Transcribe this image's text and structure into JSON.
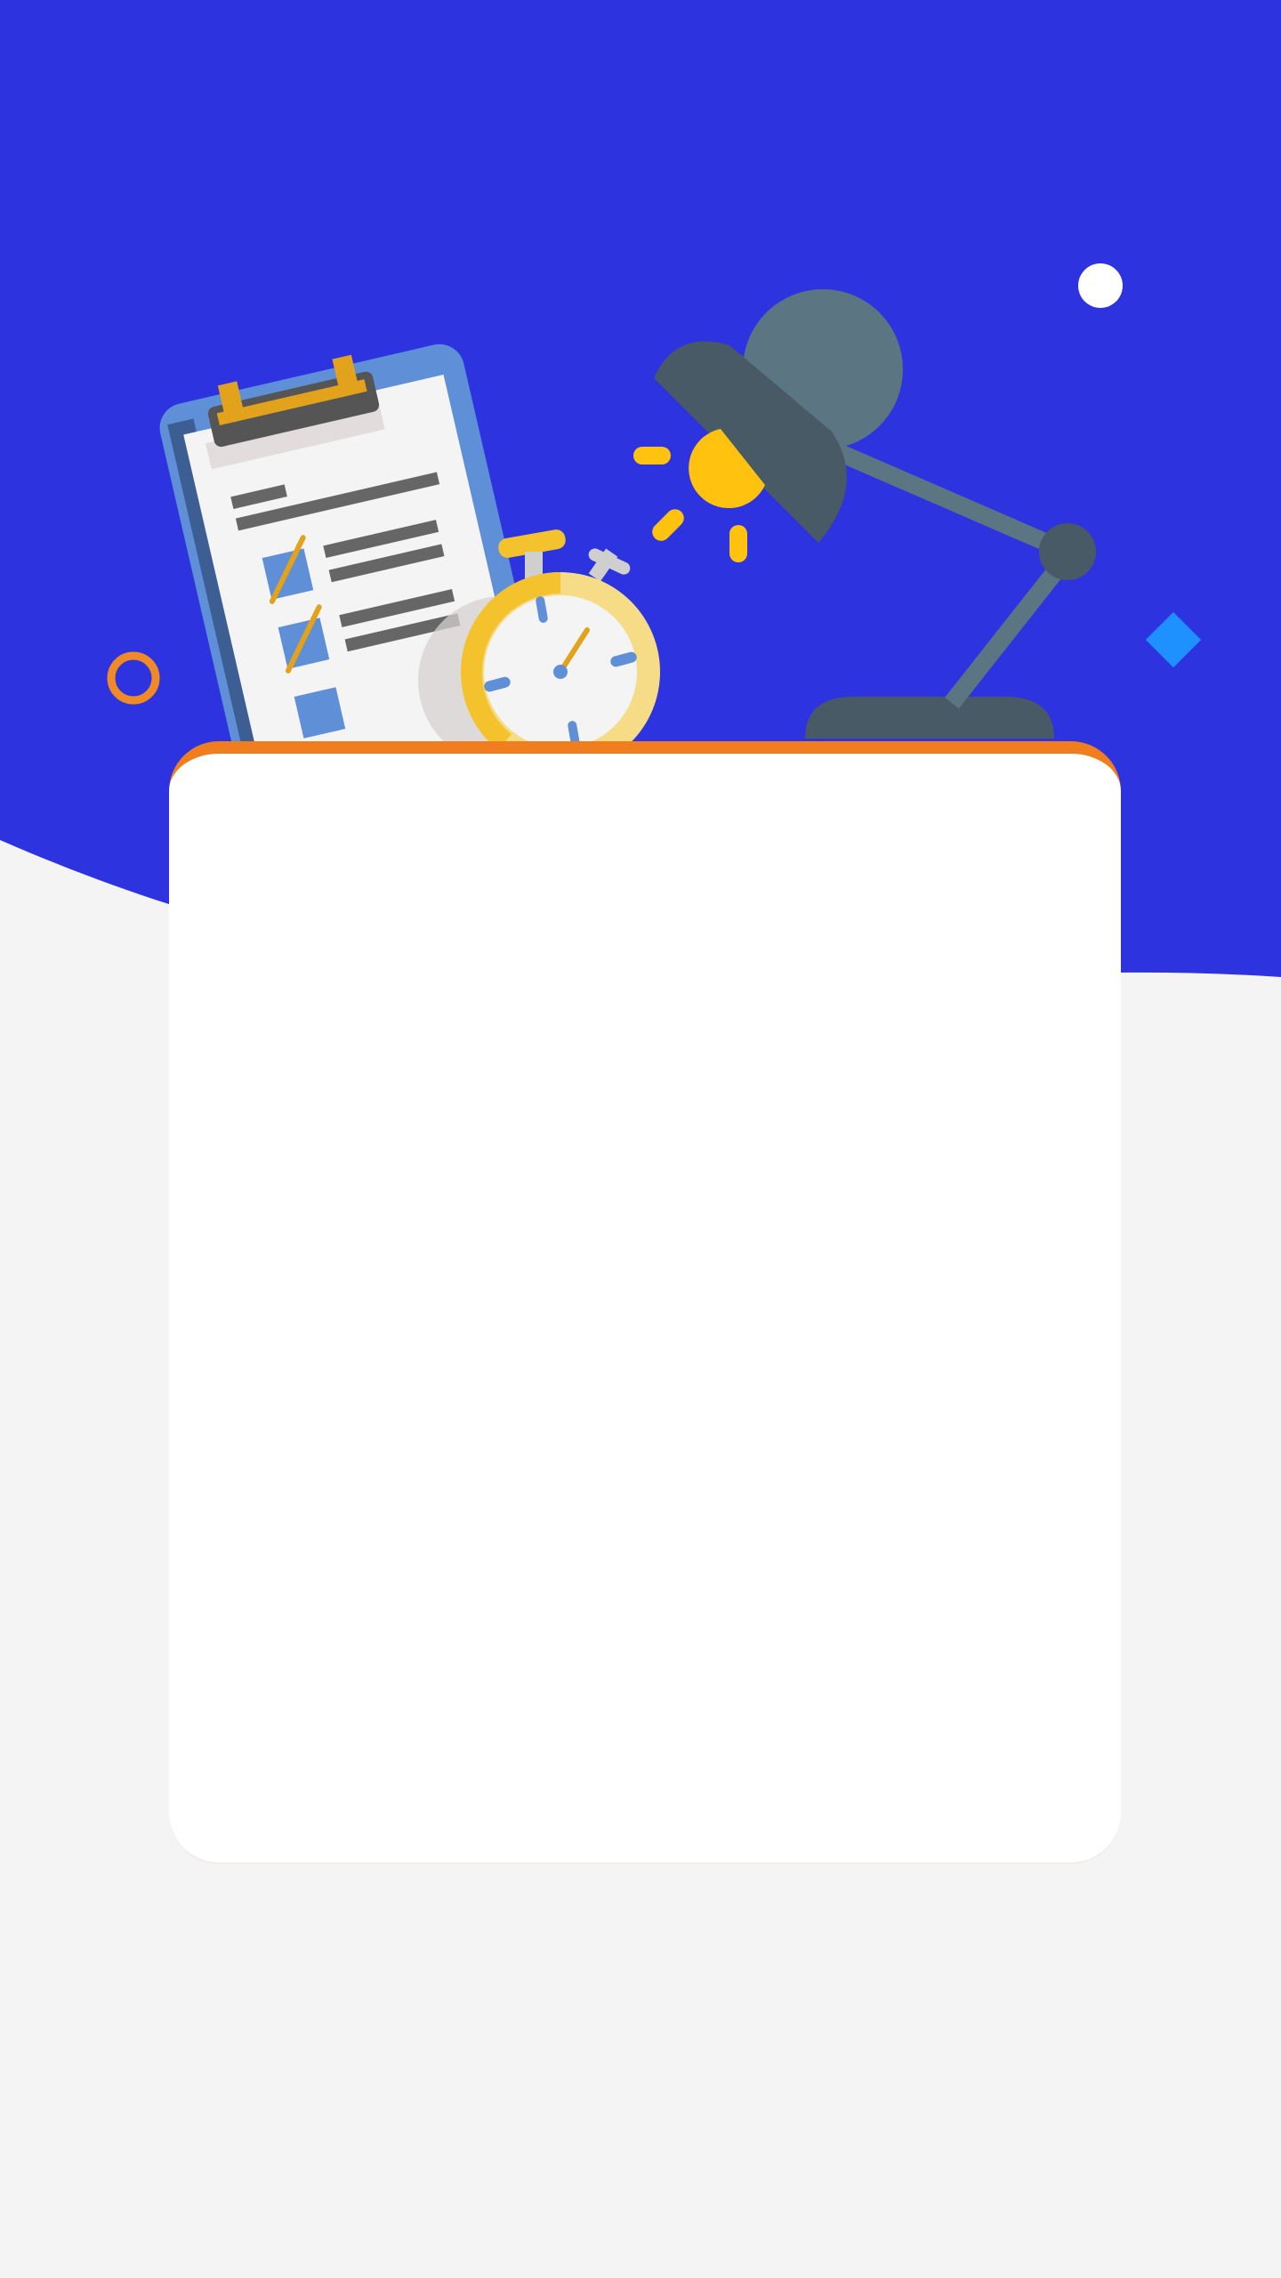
{
  "colors": {
    "hero_background": "#2e33e0",
    "page_background": "#f4f4f4",
    "card_background": "#ffffff",
    "card_accent": "#f07d1e",
    "lamp_dark": "#485a66",
    "lamp_light": "#5c7582",
    "sun": "#ffc20e",
    "clipboard_frame": "#5f8fd6",
    "stopwatch_ring": "#f3c22d",
    "diamond": "#1e90ff",
    "ring": "#f08a26"
  },
  "illustration": {
    "items": [
      "clipboard-icon",
      "stopwatch-icon",
      "desk-lamp-icon",
      "sun-icon",
      "white-dot",
      "blue-diamond",
      "orange-ring"
    ]
  },
  "card": {
    "title": "",
    "content": ""
  }
}
